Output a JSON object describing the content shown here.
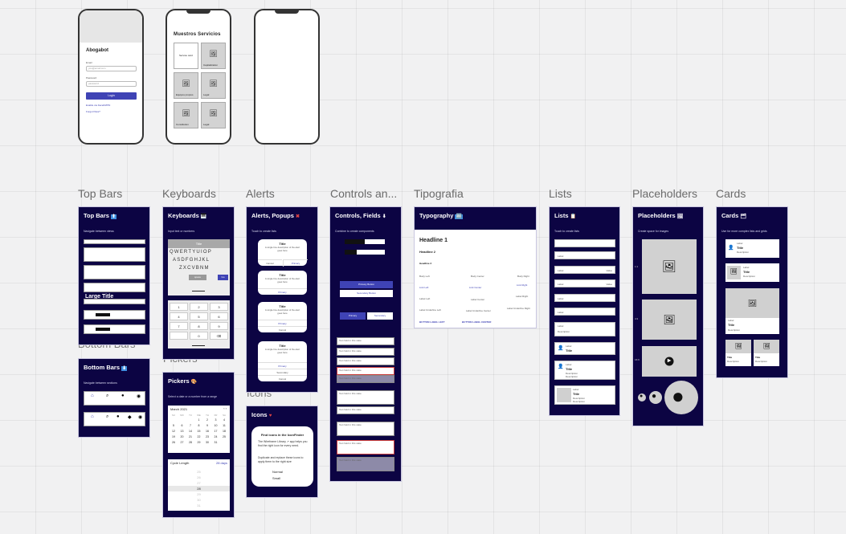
{
  "phones": {
    "login": {
      "title": "Abogabot",
      "email_label": "Email",
      "email_placeholder": "you@email.com",
      "password_label": "Password",
      "password_placeholder": "password",
      "login_button": "Login",
      "link_1": "Enable via FaceID/PIN",
      "link_2": "Forgot Pass?"
    },
    "services": {
      "title": "Muestros Servicios",
      "tiles": [
        "Service card",
        "Capitalization",
        "Equipos propios",
        "Legal",
        "Constitution",
        "Legal"
      ]
    }
  },
  "sections": {
    "top_bars": "Top Bars",
    "keyboards": "Keyboards",
    "alerts": "Alerts",
    "controls": "Controls an...",
    "typography": "Tipografia",
    "lists": "Lists",
    "placeholders": "Placeholders",
    "cards": "Cards",
    "bottom_bars": "Bottom Bars",
    "pickers": "Pickers",
    "icons": "Icons"
  },
  "frames": {
    "top_bars": {
      "title": "Top Bars",
      "subtitle": "Navigate between views",
      "large_title": "Large Title",
      "segments": [
        "One",
        "Two",
        "Three"
      ]
    },
    "bottom_bars": {
      "title": "Bottom Bars",
      "subtitle": "Navigate between sections",
      "tabs": [
        "Tab",
        "Tab",
        "Tab",
        "Tab"
      ]
    },
    "keyboards": {
      "title": "Keyboards",
      "subtitle": "Input text or numbers",
      "header": "Title",
      "row1": "QWERTYUIOP",
      "row2": "ASDFGHJKL",
      "row3": "ZXCVBNM",
      "go": "Go",
      "space": "space",
      "numpad": [
        "1",
        "2",
        "3",
        "4",
        "5",
        "6",
        "7",
        "8",
        "9",
        "",
        "0",
        "⌫"
      ]
    },
    "pickers": {
      "title": "Pickers",
      "subtitle": "Select a date or a number from a range",
      "month": "March 2021",
      "weekdays": [
        "SU",
        "MO",
        "TU",
        "WE",
        "TH",
        "FR",
        "SA"
      ],
      "days": [
        "",
        "",
        "",
        "1",
        "2",
        "3",
        "4",
        "5",
        "6",
        "7",
        "8",
        "9",
        "10",
        "11",
        "12",
        "13",
        "14",
        "15",
        "16",
        "17",
        "18",
        "19",
        "20",
        "21",
        "22",
        "23",
        "24",
        "25",
        "26",
        "27",
        "28",
        "29",
        "30",
        "31",
        ""
      ],
      "cycle_label": "Cycle Length",
      "cycle_value": "28 days",
      "wheel": [
        "25",
        "26",
        "27",
        "28",
        "29",
        "30",
        "31"
      ]
    },
    "alerts": {
      "title": "Alerts, Popups",
      "subtitle": "Touch to create lists",
      "alert_title": "Title",
      "alert_desc": "A single line description of the alert goes here",
      "cancel": "Cancel",
      "primary": "Primary",
      "secondary": "Secondary"
    },
    "icons": {
      "title": "Icons",
      "heading": "Find icons in the IconFinder",
      "body_1": "The Wireframe Library ↗ app helps you find the right icon for every need.",
      "body_2": "Duplicate and replace these icons to apply them to the right size",
      "normal": "Normal",
      "small": "Small"
    },
    "controls": {
      "title": "Controls, Fields",
      "subtitle": "Combine to create components",
      "segments": [
        "Yes",
        "No"
      ],
      "primary_button": "Primary Button",
      "secondary_button": "Secondary Button",
      "primary": "Primary",
      "secondary": "Secondary",
      "field_placeholder": "Text field in this state"
    },
    "typography": {
      "title": "Typography",
      "h1": "Headline 1",
      "h2": "Headline 2",
      "h3": "Headline 3",
      "body_left": "Body Left",
      "body_center": "Body Center",
      "body_right": "Body Right",
      "link_left": "Link Left",
      "link_center": "Link Center",
      "link_right": "Link Right",
      "label_left": "Label Left",
      "label_center": "Label Center",
      "label_right": "Label Right",
      "label_underline_left": "Label Underline Left",
      "label_underline_center": "Label Underline Center",
      "label_underline_right": "Label Underline Right",
      "button_left": "BUTTON LABEL LEFT",
      "button_center": "BUTTON LABEL CENTER"
    },
    "lists": {
      "title": "Lists",
      "subtitle": "Touch to create lists",
      "row_label": "Label",
      "row_value": "Value",
      "item_title": "Title",
      "item_desc": "Description"
    },
    "placeholders": {
      "title": "Placeholders",
      "subtitle": "Create space for images",
      "sizes": [
        "1:1",
        "4:3",
        "16:9"
      ]
    },
    "cards": {
      "title": "Cards",
      "subtitle": "Use for more complex lists and grids",
      "label": "Label",
      "card_title": "Title",
      "description": "Description"
    }
  },
  "colors": {
    "navy": "#0c0443",
    "accent": "#3f43b5",
    "canvas": "#f1f1f2"
  }
}
